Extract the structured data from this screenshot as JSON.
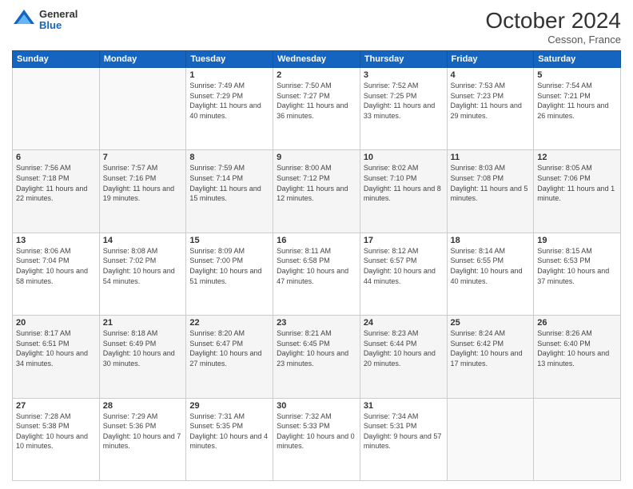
{
  "header": {
    "logo_general": "General",
    "logo_blue": "Blue",
    "month_title": "October 2024",
    "location": "Cesson, France"
  },
  "days_of_week": [
    "Sunday",
    "Monday",
    "Tuesday",
    "Wednesday",
    "Thursday",
    "Friday",
    "Saturday"
  ],
  "weeks": [
    [
      {
        "day": "",
        "sunrise": "",
        "sunset": "",
        "daylight": ""
      },
      {
        "day": "",
        "sunrise": "",
        "sunset": "",
        "daylight": ""
      },
      {
        "day": "1",
        "sunrise": "Sunrise: 7:49 AM",
        "sunset": "Sunset: 7:29 PM",
        "daylight": "Daylight: 11 hours and 40 minutes."
      },
      {
        "day": "2",
        "sunrise": "Sunrise: 7:50 AM",
        "sunset": "Sunset: 7:27 PM",
        "daylight": "Daylight: 11 hours and 36 minutes."
      },
      {
        "day": "3",
        "sunrise": "Sunrise: 7:52 AM",
        "sunset": "Sunset: 7:25 PM",
        "daylight": "Daylight: 11 hours and 33 minutes."
      },
      {
        "day": "4",
        "sunrise": "Sunrise: 7:53 AM",
        "sunset": "Sunset: 7:23 PM",
        "daylight": "Daylight: 11 hours and 29 minutes."
      },
      {
        "day": "5",
        "sunrise": "Sunrise: 7:54 AM",
        "sunset": "Sunset: 7:21 PM",
        "daylight": "Daylight: 11 hours and 26 minutes."
      }
    ],
    [
      {
        "day": "6",
        "sunrise": "Sunrise: 7:56 AM",
        "sunset": "Sunset: 7:18 PM",
        "daylight": "Daylight: 11 hours and 22 minutes."
      },
      {
        "day": "7",
        "sunrise": "Sunrise: 7:57 AM",
        "sunset": "Sunset: 7:16 PM",
        "daylight": "Daylight: 11 hours and 19 minutes."
      },
      {
        "day": "8",
        "sunrise": "Sunrise: 7:59 AM",
        "sunset": "Sunset: 7:14 PM",
        "daylight": "Daylight: 11 hours and 15 minutes."
      },
      {
        "day": "9",
        "sunrise": "Sunrise: 8:00 AM",
        "sunset": "Sunset: 7:12 PM",
        "daylight": "Daylight: 11 hours and 12 minutes."
      },
      {
        "day": "10",
        "sunrise": "Sunrise: 8:02 AM",
        "sunset": "Sunset: 7:10 PM",
        "daylight": "Daylight: 11 hours and 8 minutes."
      },
      {
        "day": "11",
        "sunrise": "Sunrise: 8:03 AM",
        "sunset": "Sunset: 7:08 PM",
        "daylight": "Daylight: 11 hours and 5 minutes."
      },
      {
        "day": "12",
        "sunrise": "Sunrise: 8:05 AM",
        "sunset": "Sunset: 7:06 PM",
        "daylight": "Daylight: 11 hours and 1 minute."
      }
    ],
    [
      {
        "day": "13",
        "sunrise": "Sunrise: 8:06 AM",
        "sunset": "Sunset: 7:04 PM",
        "daylight": "Daylight: 10 hours and 58 minutes."
      },
      {
        "day": "14",
        "sunrise": "Sunrise: 8:08 AM",
        "sunset": "Sunset: 7:02 PM",
        "daylight": "Daylight: 10 hours and 54 minutes."
      },
      {
        "day": "15",
        "sunrise": "Sunrise: 8:09 AM",
        "sunset": "Sunset: 7:00 PM",
        "daylight": "Daylight: 10 hours and 51 minutes."
      },
      {
        "day": "16",
        "sunrise": "Sunrise: 8:11 AM",
        "sunset": "Sunset: 6:58 PM",
        "daylight": "Daylight: 10 hours and 47 minutes."
      },
      {
        "day": "17",
        "sunrise": "Sunrise: 8:12 AM",
        "sunset": "Sunset: 6:57 PM",
        "daylight": "Daylight: 10 hours and 44 minutes."
      },
      {
        "day": "18",
        "sunrise": "Sunrise: 8:14 AM",
        "sunset": "Sunset: 6:55 PM",
        "daylight": "Daylight: 10 hours and 40 minutes."
      },
      {
        "day": "19",
        "sunrise": "Sunrise: 8:15 AM",
        "sunset": "Sunset: 6:53 PM",
        "daylight": "Daylight: 10 hours and 37 minutes."
      }
    ],
    [
      {
        "day": "20",
        "sunrise": "Sunrise: 8:17 AM",
        "sunset": "Sunset: 6:51 PM",
        "daylight": "Daylight: 10 hours and 34 minutes."
      },
      {
        "day": "21",
        "sunrise": "Sunrise: 8:18 AM",
        "sunset": "Sunset: 6:49 PM",
        "daylight": "Daylight: 10 hours and 30 minutes."
      },
      {
        "day": "22",
        "sunrise": "Sunrise: 8:20 AM",
        "sunset": "Sunset: 6:47 PM",
        "daylight": "Daylight: 10 hours and 27 minutes."
      },
      {
        "day": "23",
        "sunrise": "Sunrise: 8:21 AM",
        "sunset": "Sunset: 6:45 PM",
        "daylight": "Daylight: 10 hours and 23 minutes."
      },
      {
        "day": "24",
        "sunrise": "Sunrise: 8:23 AM",
        "sunset": "Sunset: 6:44 PM",
        "daylight": "Daylight: 10 hours and 20 minutes."
      },
      {
        "day": "25",
        "sunrise": "Sunrise: 8:24 AM",
        "sunset": "Sunset: 6:42 PM",
        "daylight": "Daylight: 10 hours and 17 minutes."
      },
      {
        "day": "26",
        "sunrise": "Sunrise: 8:26 AM",
        "sunset": "Sunset: 6:40 PM",
        "daylight": "Daylight: 10 hours and 13 minutes."
      }
    ],
    [
      {
        "day": "27",
        "sunrise": "Sunrise: 7:28 AM",
        "sunset": "Sunset: 5:38 PM",
        "daylight": "Daylight: 10 hours and 10 minutes."
      },
      {
        "day": "28",
        "sunrise": "Sunrise: 7:29 AM",
        "sunset": "Sunset: 5:36 PM",
        "daylight": "Daylight: 10 hours and 7 minutes."
      },
      {
        "day": "29",
        "sunrise": "Sunrise: 7:31 AM",
        "sunset": "Sunset: 5:35 PM",
        "daylight": "Daylight: 10 hours and 4 minutes."
      },
      {
        "day": "30",
        "sunrise": "Sunrise: 7:32 AM",
        "sunset": "Sunset: 5:33 PM",
        "daylight": "Daylight: 10 hours and 0 minutes."
      },
      {
        "day": "31",
        "sunrise": "Sunrise: 7:34 AM",
        "sunset": "Sunset: 5:31 PM",
        "daylight": "Daylight: 9 hours and 57 minutes."
      },
      {
        "day": "",
        "sunrise": "",
        "sunset": "",
        "daylight": ""
      },
      {
        "day": "",
        "sunrise": "",
        "sunset": "",
        "daylight": ""
      }
    ]
  ]
}
